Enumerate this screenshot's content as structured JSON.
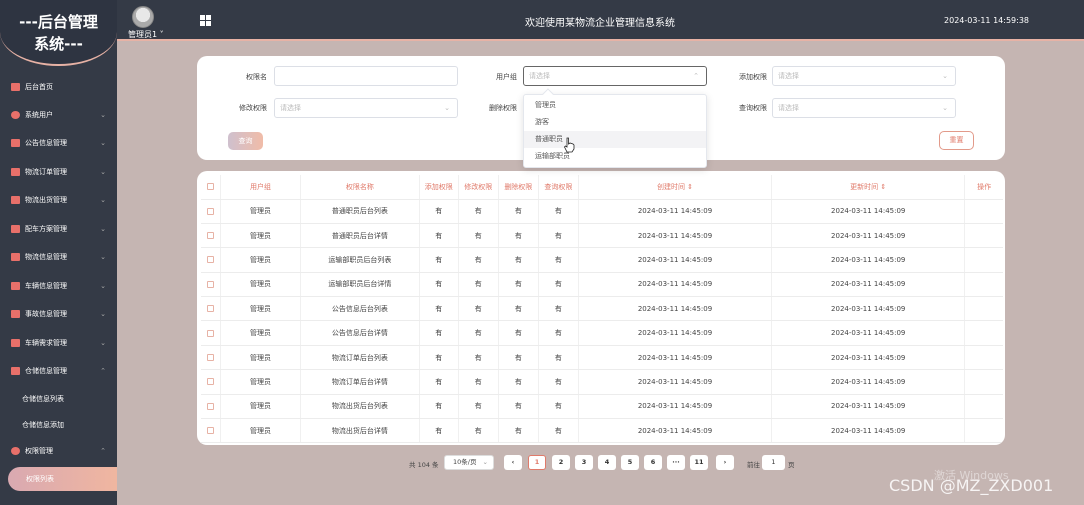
{
  "brand": {
    "line1": "---后台管理",
    "line2": "系统---"
  },
  "header": {
    "admin": "管理员1 ˅",
    "title": "欢迎使用某物流企业管理信息系统",
    "datetime": "2024-03-11 14:59:38"
  },
  "sidebar": {
    "items": [
      {
        "label": "后台首页"
      },
      {
        "label": "系统用户"
      },
      {
        "label": "公告信息管理"
      },
      {
        "label": "物流订单管理"
      },
      {
        "label": "物流出货管理"
      },
      {
        "label": "配车方案管理"
      },
      {
        "label": "物流信息管理"
      },
      {
        "label": "车辆信息管理"
      },
      {
        "label": "事故信息管理"
      },
      {
        "label": "车辆需求管理"
      },
      {
        "label": "仓储信息管理"
      }
    ],
    "sub_storage": [
      "仓储信息列表",
      "仓储信息添加"
    ],
    "perm_menu": "权限管理",
    "perm_active": "权限列表"
  },
  "search": {
    "perm_name_label": "权限名",
    "user_group_label": "用户组",
    "add_perm_label": "添加权限",
    "edit_perm_label": "修改权限",
    "delete_perm_label": "删除权限",
    "query_perm_label": "查询权限",
    "placeholder": "请选择",
    "query_btn": "查询",
    "reset_btn": "重置"
  },
  "dropdown": {
    "options": [
      "管理员",
      "游客",
      "普通职员",
      "运输部职员"
    ],
    "hovered": "普通职员"
  },
  "table": {
    "headers": [
      "用户组",
      "权限名称",
      "添加权限",
      "修改权限",
      "删除权限",
      "查询权限",
      "创建时间 ⇕",
      "更新时间 ⇕",
      "操作"
    ],
    "rows": [
      [
        "管理员",
        "普通职员后台列表",
        "有",
        "有",
        "有",
        "有",
        "2024-03-11 14:45:09",
        "2024-03-11 14:45:09"
      ],
      [
        "管理员",
        "普通职员后台详情",
        "有",
        "有",
        "有",
        "有",
        "2024-03-11 14:45:09",
        "2024-03-11 14:45:09"
      ],
      [
        "管理员",
        "运输部职员后台列表",
        "有",
        "有",
        "有",
        "有",
        "2024-03-11 14:45:09",
        "2024-03-11 14:45:09"
      ],
      [
        "管理员",
        "运输部职员后台详情",
        "有",
        "有",
        "有",
        "有",
        "2024-03-11 14:45:09",
        "2024-03-11 14:45:09"
      ],
      [
        "管理员",
        "公告信息后台列表",
        "有",
        "有",
        "有",
        "有",
        "2024-03-11 14:45:09",
        "2024-03-11 14:45:09"
      ],
      [
        "管理员",
        "公告信息后台详情",
        "有",
        "有",
        "有",
        "有",
        "2024-03-11 14:45:09",
        "2024-03-11 14:45:09"
      ],
      [
        "管理员",
        "物流订单后台列表",
        "有",
        "有",
        "有",
        "有",
        "2024-03-11 14:45:09",
        "2024-03-11 14:45:09"
      ],
      [
        "管理员",
        "物流订单后台详情",
        "有",
        "有",
        "有",
        "有",
        "2024-03-11 14:45:09",
        "2024-03-11 14:45:09"
      ],
      [
        "管理员",
        "物流出货后台列表",
        "有",
        "有",
        "有",
        "有",
        "2024-03-11 14:45:09",
        "2024-03-11 14:45:09"
      ],
      [
        "管理员",
        "物流出货后台详情",
        "有",
        "有",
        "有",
        "有",
        "2024-03-11 14:45:09",
        "2024-03-11 14:45:09"
      ]
    ]
  },
  "pagination": {
    "total": "共 104 条",
    "page_size": "10条/页",
    "pages": [
      "1",
      "2",
      "3",
      "4",
      "5",
      "6",
      "···",
      "11"
    ],
    "prev": "‹",
    "next": "›",
    "goto": "前往",
    "goto_value": "1",
    "unit": "页"
  },
  "watermark": "激活 Windows",
  "csdn": "CSDN @MZ_ZXD001",
  "colors": {
    "accent": "#e07a6a",
    "sidebar": "#343a46",
    "background": "#c5b5b2"
  }
}
